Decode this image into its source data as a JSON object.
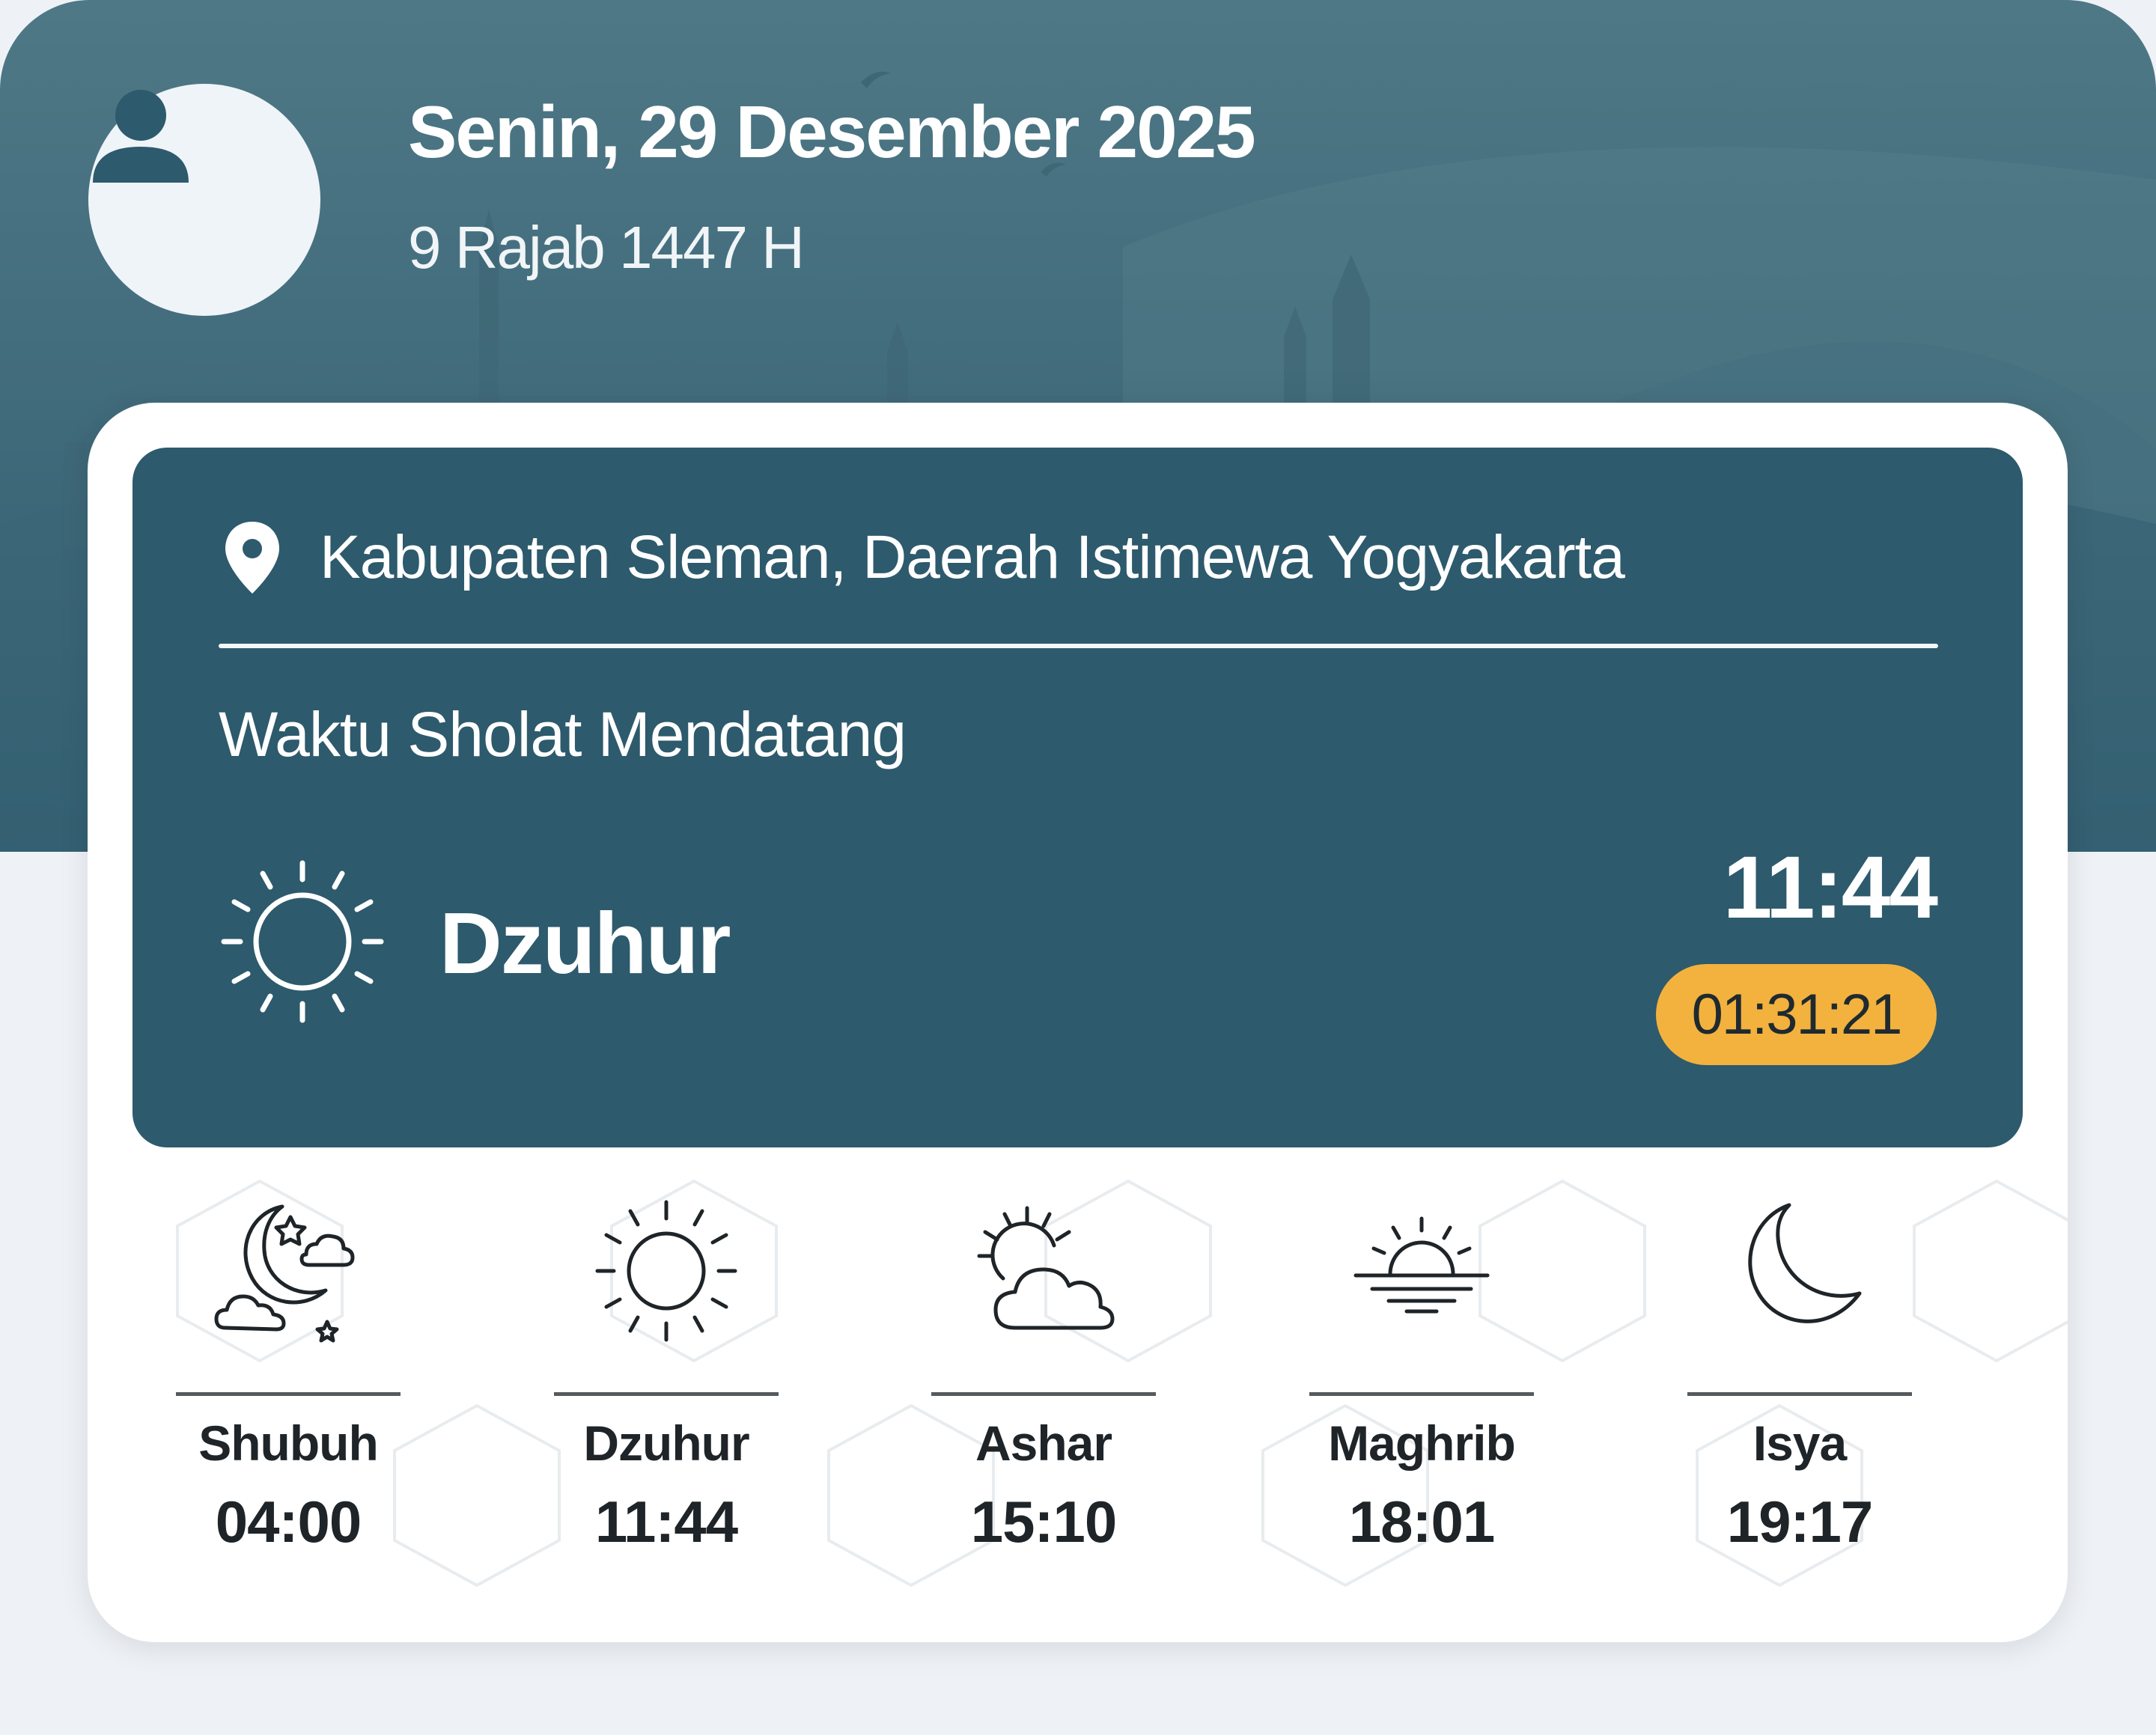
{
  "header": {
    "gregorian_date": "Senin, 29 Desember 2025",
    "hijri_date": "9 Rajab 1447 H",
    "avatar_icon": "user-icon"
  },
  "next_prayer": {
    "location_icon": "location-pin-icon",
    "location": "Kabupaten Sleman, Daerah Istimewa Yogyakarta",
    "section_label": "Waktu Sholat Mendatang",
    "icon": "sun-icon",
    "name": "Dzuhur",
    "time": "11:44",
    "countdown": "01:31:21"
  },
  "prayers": [
    {
      "name": "Shubuh",
      "time": "04:00",
      "icon": "moon-stars-cloud-icon"
    },
    {
      "name": "Dzuhur",
      "time": "11:44",
      "icon": "sun-icon"
    },
    {
      "name": "Ashar",
      "time": "15:10",
      "icon": "sun-cloud-icon"
    },
    {
      "name": "Maghrib",
      "time": "18:01",
      "icon": "sunset-icon"
    },
    {
      "name": "Isya",
      "time": "19:17",
      "icon": "crescent-moon-icon"
    }
  ],
  "colors": {
    "header_bg": "#416c7c",
    "panel_bg": "#2d5a6c",
    "countdown_bg": "#f3b23d",
    "page_bg": "#eef2f6"
  }
}
